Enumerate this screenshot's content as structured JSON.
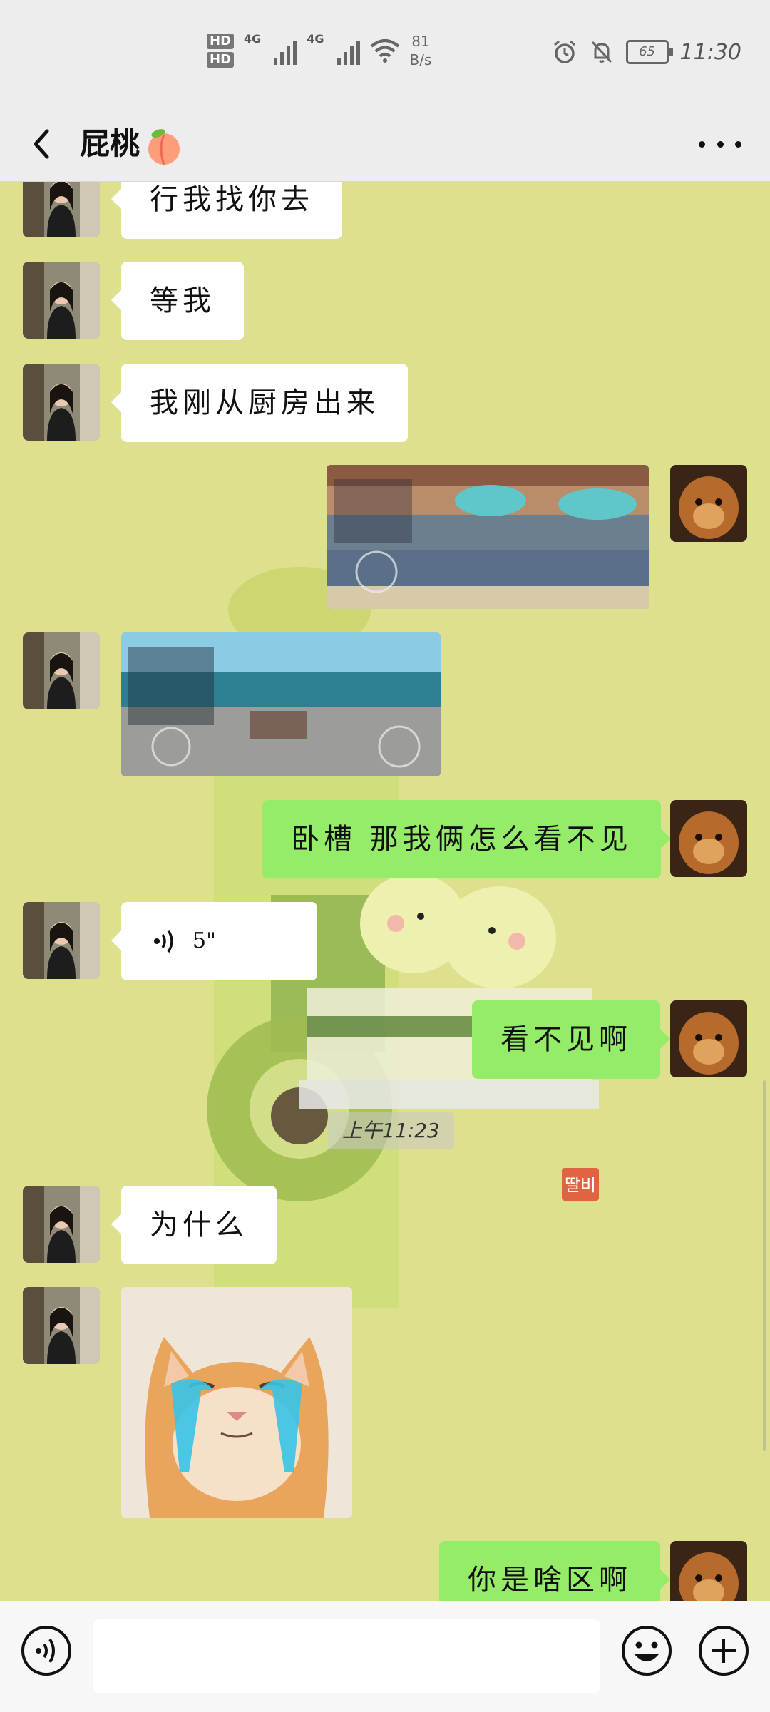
{
  "status_bar": {
    "hd1": "HD",
    "hd2": "HD",
    "net1": "4G",
    "net2": "4G",
    "speed_value": "81",
    "speed_unit": "B/s",
    "battery": "65",
    "time": "11:30"
  },
  "header": {
    "title": "屁桃"
  },
  "messages": [
    {
      "side": "left",
      "type": "text",
      "text": "行我找你去"
    },
    {
      "side": "left",
      "type": "text",
      "text": "等我"
    },
    {
      "side": "left",
      "type": "text",
      "text": "我刚从厨房出来"
    },
    {
      "side": "right",
      "type": "image",
      "alt": "game screenshot"
    },
    {
      "side": "left",
      "type": "image",
      "alt": "game screenshot"
    },
    {
      "side": "right",
      "type": "text",
      "text": "卧槽 那我俩怎么看不见"
    },
    {
      "side": "left",
      "type": "voice",
      "text": "5\""
    },
    {
      "side": "right",
      "type": "text",
      "text": "看不见啊"
    },
    {
      "side": "left",
      "type": "text",
      "text": "为什么"
    },
    {
      "side": "left",
      "type": "sticker",
      "alt": "crying cat"
    },
    {
      "side": "right",
      "type": "text",
      "text": "你是啥区啊"
    }
  ],
  "timestamp": "上午11:23",
  "wallpaper_stamp": "딸비",
  "colors": {
    "chat_background": "#dde08c",
    "bubble_sent": "#95ec69",
    "bubble_received": "#ffffff",
    "bar_background": "#ededed"
  },
  "icons": {
    "back": "back-arrow-icon",
    "more": "more-dots-icon",
    "voice": "voice-icon",
    "emoji": "emoji-icon",
    "plus": "plus-icon"
  }
}
